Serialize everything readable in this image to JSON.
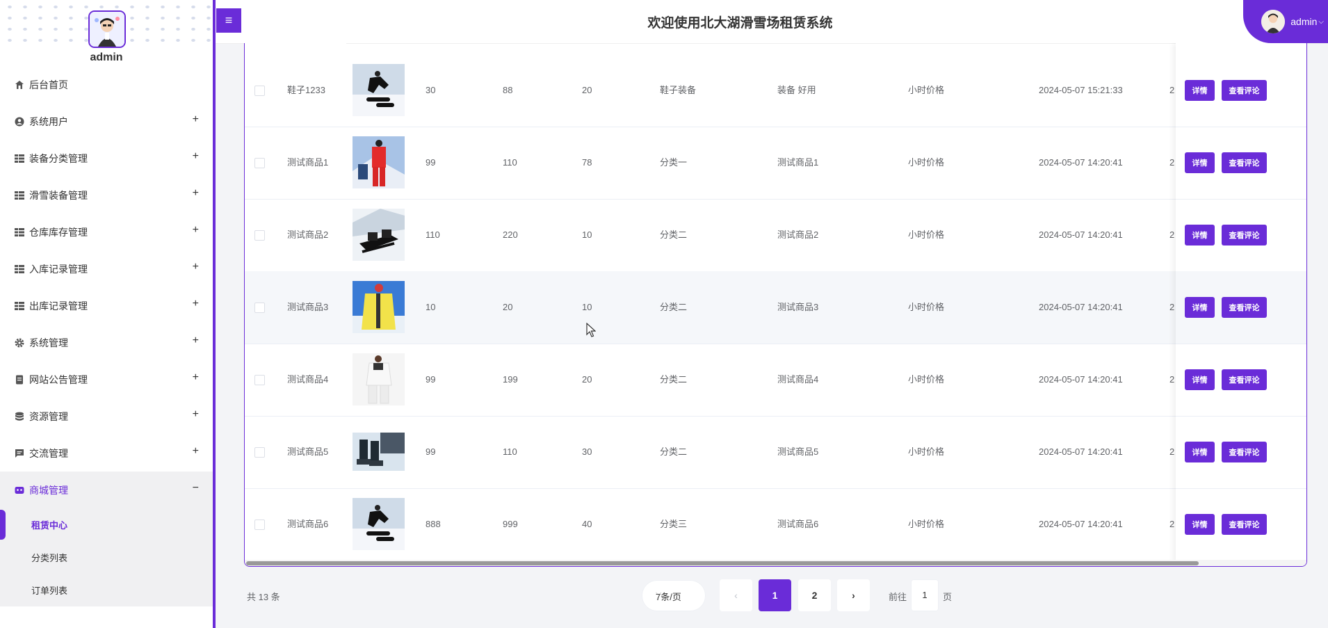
{
  "sidebar": {
    "username": "admin",
    "menu": [
      {
        "label": "后台首页",
        "icon": "home-icon",
        "toggle": ""
      },
      {
        "label": "系统用户",
        "icon": "user-circle-icon",
        "toggle": "+"
      },
      {
        "label": "装备分类管理",
        "icon": "grid-icon",
        "toggle": "+"
      },
      {
        "label": "滑雪装备管理",
        "icon": "grid-icon",
        "toggle": "+"
      },
      {
        "label": "仓库库存管理",
        "icon": "grid-icon",
        "toggle": "+"
      },
      {
        "label": "入库记录管理",
        "icon": "grid-icon",
        "toggle": "+"
      },
      {
        "label": "出库记录管理",
        "icon": "grid-icon",
        "toggle": "+"
      },
      {
        "label": "系统管理",
        "icon": "gear-icon",
        "toggle": "+"
      },
      {
        "label": "网站公告管理",
        "icon": "document-icon",
        "toggle": "+"
      },
      {
        "label": "资源管理",
        "icon": "database-icon",
        "toggle": "+"
      },
      {
        "label": "交流管理",
        "icon": "chat-icon",
        "toggle": "+"
      },
      {
        "label": "商城管理",
        "icon": "store-icon",
        "toggle": "−"
      }
    ],
    "submenu": [
      {
        "label": "租赁中心"
      },
      {
        "label": "分类列表"
      },
      {
        "label": "订单列表"
      }
    ]
  },
  "header": {
    "menu_toggle": "≡",
    "title": "欢迎使用北大湖滑雪场租赁系统",
    "user": "admin"
  },
  "table": {
    "rows": [
      {
        "name": "鞋子1233",
        "c1": "30",
        "c2": "88",
        "c3": "20",
        "category": "鞋子装备",
        "desc": "装备 好用",
        "price_type": "小时价格",
        "time": "2024-05-07 15:21:33",
        "tail": "2"
      },
      {
        "name": "测试商品1",
        "c1": "99",
        "c2": "110",
        "c3": "78",
        "category": "分类一",
        "desc": "测试商品1",
        "price_type": "小时价格",
        "time": "2024-05-07 14:20:41",
        "tail": "2"
      },
      {
        "name": "测试商品2",
        "c1": "110",
        "c2": "220",
        "c3": "10",
        "category": "分类二",
        "desc": "测试商品2",
        "price_type": "小时价格",
        "time": "2024-05-07 14:20:41",
        "tail": "2"
      },
      {
        "name": "测试商品3",
        "c1": "10",
        "c2": "20",
        "c3": "10",
        "category": "分类二",
        "desc": "测试商品3",
        "price_type": "小时价格",
        "time": "2024-05-07 14:20:41",
        "tail": "2"
      },
      {
        "name": "测试商品4",
        "c1": "99",
        "c2": "199",
        "c3": "20",
        "category": "分类二",
        "desc": "测试商品4",
        "price_type": "小时价格",
        "time": "2024-05-07 14:20:41",
        "tail": "2"
      },
      {
        "name": "测试商品5",
        "c1": "99",
        "c2": "110",
        "c3": "30",
        "category": "分类二",
        "desc": "测试商品5",
        "price_type": "小时价格",
        "time": "2024-05-07 14:20:41",
        "tail": "2"
      },
      {
        "name": "测试商品6",
        "c1": "888",
        "c2": "999",
        "c3": "40",
        "category": "分类三",
        "desc": "测试商品6",
        "price_type": "小时价格",
        "time": "2024-05-07 14:20:41",
        "tail": "2"
      }
    ],
    "detail_label": "详情",
    "comment_label": "查看评论"
  },
  "pagination": {
    "total": "共 13 条",
    "page_size": "7条/页",
    "prev": "‹",
    "pages": [
      "1",
      "2"
    ],
    "next": "›",
    "goto_prefix": "前往",
    "goto_value": "1",
    "goto_suffix": "页"
  },
  "colors": {
    "accent": "#6a2cd8"
  }
}
